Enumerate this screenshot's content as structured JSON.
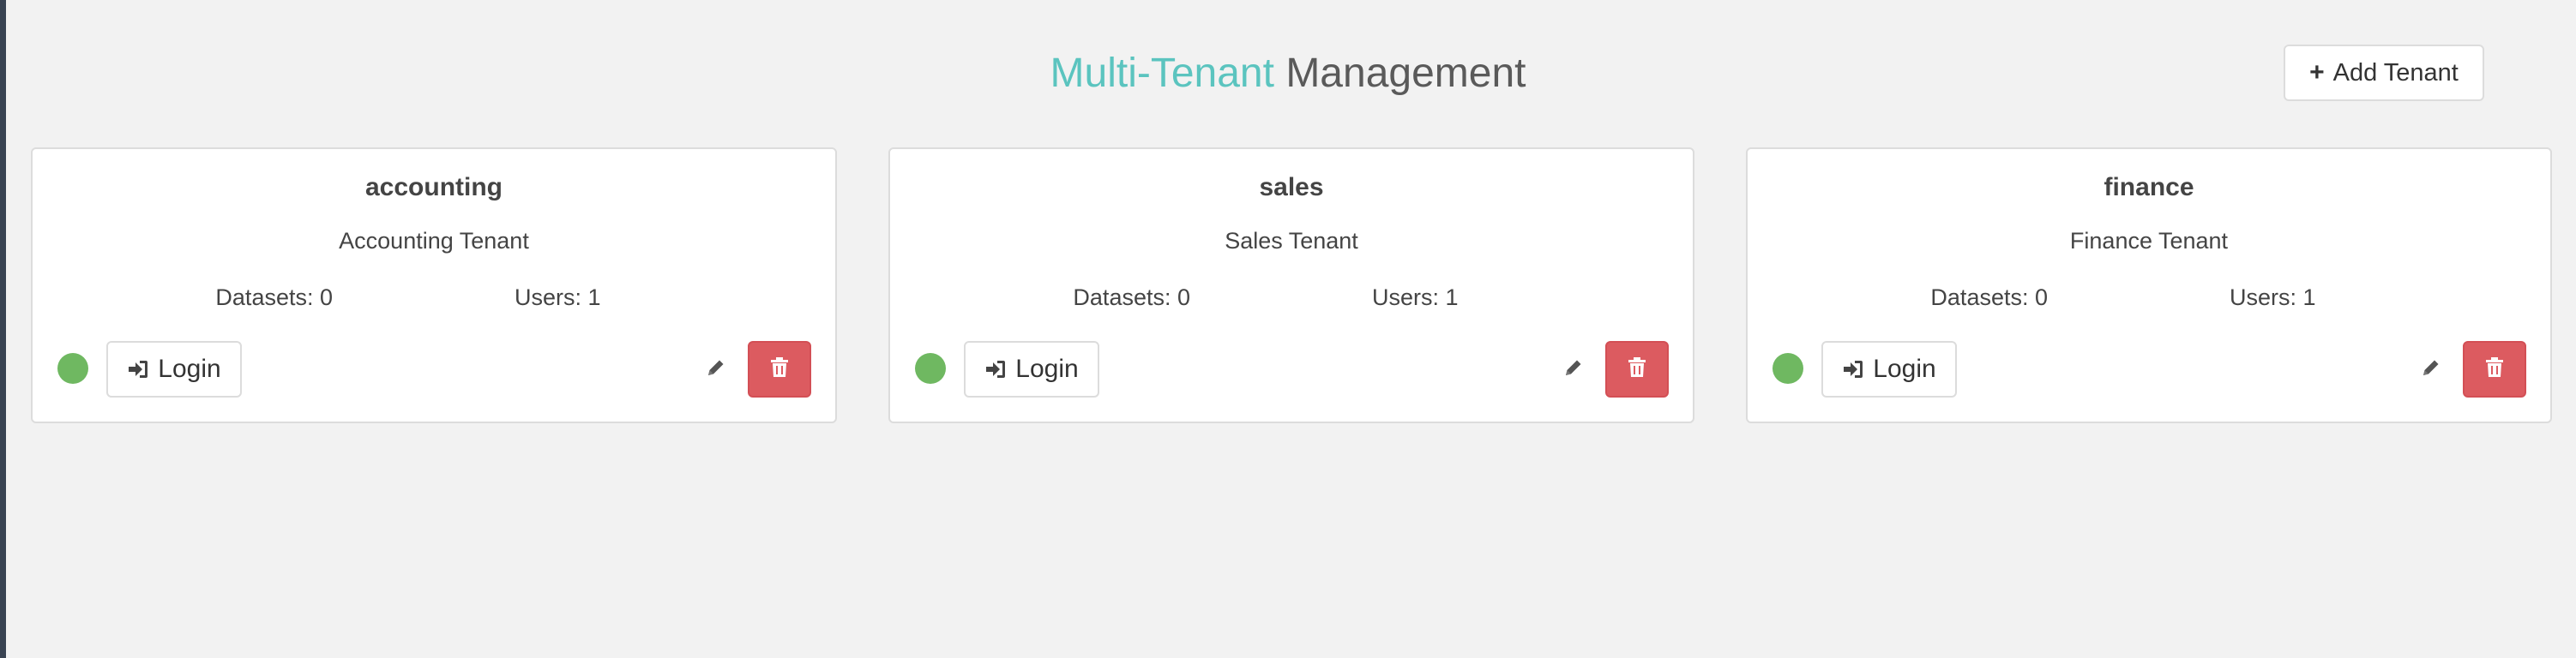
{
  "header": {
    "title_accent": "Multi-Tenant",
    "title_main": "Management",
    "add_tenant_label": "Add Tenant"
  },
  "colors": {
    "accent": "#5bc4bf",
    "status_active": "#6fb861",
    "danger": "#dc5b60"
  },
  "tenants": [
    {
      "name": "accounting",
      "description": "Accounting Tenant",
      "datasets_text": "Datasets: 0",
      "users_text": "Users: 1",
      "status": "active",
      "login_label": "Login"
    },
    {
      "name": "sales",
      "description": "Sales Tenant",
      "datasets_text": "Datasets: 0",
      "users_text": "Users: 1",
      "status": "active",
      "login_label": "Login"
    },
    {
      "name": "finance",
      "description": "Finance Tenant",
      "datasets_text": "Datasets: 0",
      "users_text": "Users: 1",
      "status": "active",
      "login_label": "Login"
    }
  ],
  "icons": {
    "add": "plus-icon",
    "login": "sign-in-icon",
    "edit": "pencil-icon",
    "delete": "trash-icon",
    "status": "status-dot"
  }
}
